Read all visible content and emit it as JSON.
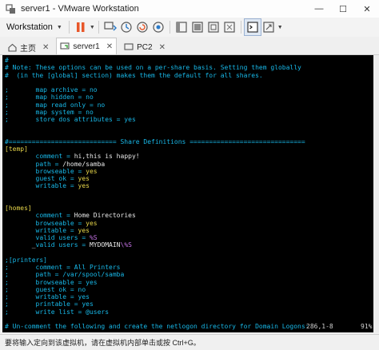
{
  "window": {
    "title": "server1 - VMware Workstation",
    "controls": [
      "—",
      "☐",
      "✕"
    ]
  },
  "toolbar": {
    "workspace_label": "Workstation"
  },
  "tabs": [
    {
      "label": "主页",
      "active": false
    },
    {
      "label": "server1",
      "active": true
    },
    {
      "label": "PC2",
      "active": false
    }
  ],
  "terminal": {
    "lines": [
      [
        {
          "t": "#",
          "c": "cyan"
        }
      ],
      [
        {
          "t": "# Note: These options can be used on a per-share basis. Setting them globally",
          "c": "cyan"
        }
      ],
      [
        {
          "t": "#  (in the [global] section) makes them the default for all shares.",
          "c": "cyan"
        }
      ],
      [
        {
          "t": "",
          "c": "cyan"
        }
      ],
      [
        {
          "t": ";       map archive = no",
          "c": "cyan"
        }
      ],
      [
        {
          "t": ";       map hidden = no",
          "c": "cyan"
        }
      ],
      [
        {
          "t": ";       map read only = no",
          "c": "cyan"
        }
      ],
      [
        {
          "t": ";       map system = no",
          "c": "cyan"
        }
      ],
      [
        {
          "t": ";       store dos attributes = yes",
          "c": "cyan"
        }
      ],
      [
        {
          "t": "",
          "c": "cyan"
        }
      ],
      [
        {
          "t": "",
          "c": "cyan"
        }
      ],
      [
        {
          "t": "#============================ Share Definitions ==============================",
          "c": "cyan"
        }
      ],
      [
        {
          "t": "[temp]",
          "c": "yellow"
        }
      ],
      [
        {
          "t": "        ",
          "c": "white"
        },
        {
          "t": "comment = ",
          "c": "cyan"
        },
        {
          "t": "hi,this is happy!",
          "c": "white"
        }
      ],
      [
        {
          "t": "        ",
          "c": "white"
        },
        {
          "t": "path = ",
          "c": "cyan"
        },
        {
          "t": "/home/samba",
          "c": "white"
        }
      ],
      [
        {
          "t": "        ",
          "c": "white"
        },
        {
          "t": "browseable = ",
          "c": "cyan"
        },
        {
          "t": "yes",
          "c": "yellow"
        }
      ],
      [
        {
          "t": "        ",
          "c": "white"
        },
        {
          "t": "guest ok = ",
          "c": "cyan"
        },
        {
          "t": "yes",
          "c": "yellow"
        }
      ],
      [
        {
          "t": "        ",
          "c": "white"
        },
        {
          "t": "writable = ",
          "c": "cyan"
        },
        {
          "t": "yes",
          "c": "yellow"
        }
      ],
      [
        {
          "t": "",
          "c": "cyan"
        }
      ],
      [
        {
          "t": "",
          "c": "cyan"
        }
      ],
      [
        {
          "t": "[homes]",
          "c": "yellow"
        }
      ],
      [
        {
          "t": "        ",
          "c": "white"
        },
        {
          "t": "comment = ",
          "c": "cyan"
        },
        {
          "t": "Home Directories",
          "c": "white"
        }
      ],
      [
        {
          "t": "        ",
          "c": "white"
        },
        {
          "t": "browseable = ",
          "c": "cyan"
        },
        {
          "t": "yes",
          "c": "yellow"
        }
      ],
      [
        {
          "t": "        ",
          "c": "white"
        },
        {
          "t": "writable = ",
          "c": "cyan"
        },
        {
          "t": "yes",
          "c": "yellow"
        }
      ],
      [
        {
          "t": "        ",
          "c": "white"
        },
        {
          "t": "valid users = ",
          "c": "cyan"
        },
        {
          "t": "%S",
          "c": "magenta"
        }
      ],
      [
        {
          "t": "       _",
          "c": "white"
        },
        {
          "t": "valid users = ",
          "c": "cyan"
        },
        {
          "t": "MYDOMAIN",
          "c": "white"
        },
        {
          "t": "\\%S",
          "c": "magenta"
        }
      ],
      [
        {
          "t": "",
          "c": "cyan"
        }
      ],
      [
        {
          "t": ";[printers]",
          "c": "cyan"
        }
      ],
      [
        {
          "t": ";       comment = All Printers",
          "c": "cyan"
        }
      ],
      [
        {
          "t": ";       path = /var/spool/samba",
          "c": "cyan"
        }
      ],
      [
        {
          "t": ";       browseable = yes",
          "c": "cyan"
        }
      ],
      [
        {
          "t": ";       guest ok = no",
          "c": "cyan"
        }
      ],
      [
        {
          "t": ";       writable = yes",
          "c": "cyan"
        }
      ],
      [
        {
          "t": ";       printable = yes",
          "c": "cyan"
        }
      ],
      [
        {
          "t": ";       write list = @users",
          "c": "cyan"
        }
      ],
      [
        {
          "t": "",
          "c": "cyan"
        }
      ],
      [
        {
          "t": "# Un-comment the following and create the netlogon directory for Domain Logons:",
          "c": "cyan"
        }
      ]
    ],
    "cursor_pos": "286,1-8",
    "scroll_pct": "91%"
  },
  "statusbar": {
    "hint": "要将输入定向到该虚拟机，请在虚拟机内部单击或按 Ctrl+G。"
  },
  "colors": {
    "cyan": "#18b8e8",
    "yellow": "#e7d64a",
    "white": "#e8e8e8",
    "magenta": "#c070e0",
    "accent": "#e8572a"
  }
}
